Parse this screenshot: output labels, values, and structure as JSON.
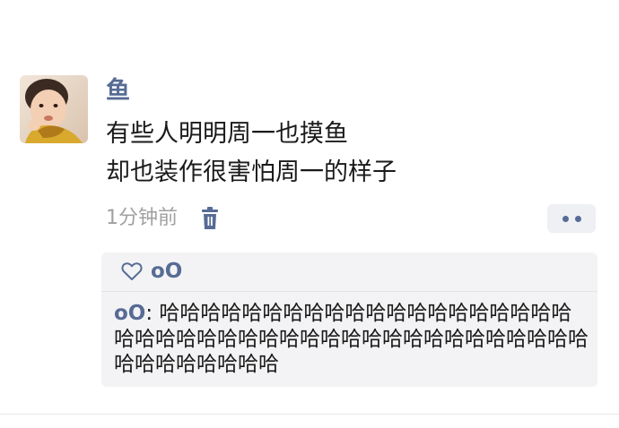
{
  "post": {
    "author": "鱼",
    "lines": [
      "有些人明明周一也摸鱼",
      "却也装作很害怕周一的样子"
    ],
    "timestamp": "1分钟前"
  },
  "icons": {
    "avatar": "baby-photo",
    "delete": "trash-icon",
    "more": "more-dots-icon",
    "like": "heart-outline-icon"
  },
  "likes": {
    "names": "oO"
  },
  "comments": [
    {
      "user": "oO",
      "separator": ": ",
      "text": "哈哈哈哈哈哈哈哈哈哈哈哈哈哈哈哈哈哈哈哈哈哈哈哈哈哈哈哈哈哈哈哈哈哈哈哈哈哈哈哈哈哈哈哈哈哈哈哈哈哈哈"
    }
  ],
  "colors": {
    "link": "#576b95",
    "panel": "#f3f3f5",
    "timestamp": "#a0a0a0"
  }
}
